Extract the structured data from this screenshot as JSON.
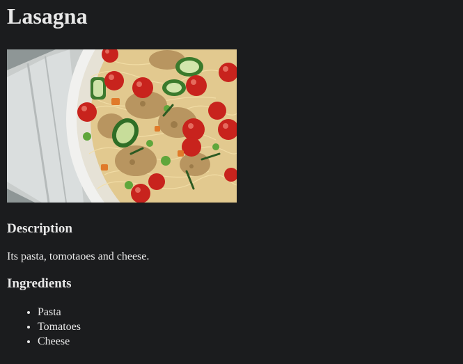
{
  "recipe": {
    "title": "Lasagna",
    "image_alt": "Pasta dish with tomatoes, zucchini and chicken",
    "description_heading": "Description",
    "description_text": "Its pasta, tomotaoes and cheese.",
    "ingredients_heading": "Ingredients",
    "ingredients": [
      "Pasta",
      "Tomatoes",
      "Cheese"
    ]
  },
  "colors": {
    "background": "#1b1c1e",
    "text": "#e8e8e8"
  }
}
